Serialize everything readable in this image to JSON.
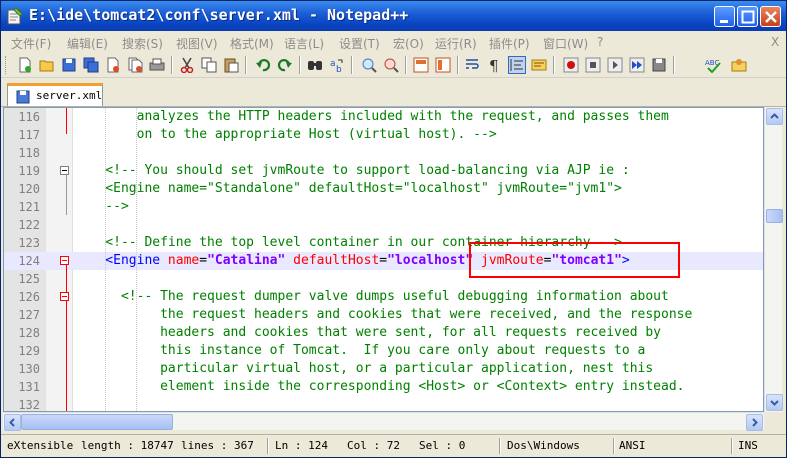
{
  "window": {
    "title": "E:\\ide\\tomcat2\\conf\\server.xml - Notepad++"
  },
  "menu": {
    "items": [
      "文件(F)",
      "编辑(E)",
      "搜索(S)",
      "视图(V)",
      "格式(M)",
      "语言(L)",
      "设置(T)",
      "宏(O)",
      "运行(R)",
      "插件(P)",
      "窗口(W)",
      "?"
    ],
    "close_glyph": "X"
  },
  "toolbar": {
    "icons": [
      "new-file-icon",
      "open-file-icon",
      "save-icon",
      "save-all-icon",
      "close-icon",
      "close-all-icon",
      "print-icon",
      "cut-icon",
      "copy-icon",
      "paste-icon",
      "undo-icon",
      "redo-icon",
      "find-icon",
      "replace-icon",
      "zoom-in-icon",
      "zoom-out-icon",
      "sync-vertical-icon",
      "sync-horizontal-icon",
      "word-wrap-icon",
      "show-all-chars-icon",
      "indent-guide-icon",
      "user-define-icon",
      "record-macro-icon",
      "stop-macro-icon",
      "play-macro-icon",
      "run-macro-multiple-icon",
      "save-macro-icon",
      "spellcheck-icon",
      "plugin-icon"
    ]
  },
  "tabs": [
    {
      "label": "server.xml",
      "active": true
    }
  ],
  "editor": {
    "current_line": 124,
    "lines": [
      {
        "num": "116",
        "parts": [
          {
            "t": "        analyzes the HTTP headers included with the request, and passes them",
            "c": "comment"
          }
        ]
      },
      {
        "num": "117",
        "parts": [
          {
            "t": "        on to the appropriate Host (virtual host). -->",
            "c": "comment"
          }
        ]
      },
      {
        "num": "118",
        "parts": []
      },
      {
        "num": "119",
        "parts": [
          {
            "t": "    <!-- You should set jvmRoute to support load-balancing via AJP ie :",
            "c": "comment"
          }
        ]
      },
      {
        "num": "120",
        "parts": [
          {
            "t": "    <Engine name=\"Standalone\" defaultHost=\"localhost\" jvmRoute=\"jvm1\">",
            "c": "comment"
          }
        ]
      },
      {
        "num": "121",
        "parts": [
          {
            "t": "    -->",
            "c": "comment"
          }
        ]
      },
      {
        "num": "122",
        "parts": []
      },
      {
        "num": "123",
        "parts": [
          {
            "t": "    <!-- Define the top level container in our container hierarchy -->",
            "c": "comment"
          }
        ]
      },
      {
        "num": "124",
        "parts": [
          {
            "t": "    <Engine ",
            "c": "tag"
          },
          {
            "t": "name",
            "c": "attr"
          },
          {
            "t": "=",
            "c": "text"
          },
          {
            "t": "\"Catalina\"",
            "c": "val"
          },
          {
            "t": " ",
            "c": "text"
          },
          {
            "t": "defaultHost",
            "c": "attr"
          },
          {
            "t": "=",
            "c": "text"
          },
          {
            "t": "\"localhost\"",
            "c": "val"
          },
          {
            "t": " ",
            "c": "text"
          },
          {
            "t": "jvmRoute",
            "c": "attr"
          },
          {
            "t": "=",
            "c": "text"
          },
          {
            "t": "\"tomcat1\"",
            "c": "val"
          },
          {
            "t": ">",
            "c": "tag"
          }
        ]
      },
      {
        "num": "125",
        "parts": []
      },
      {
        "num": "126",
        "parts": [
          {
            "t": "      <!-- The request dumper valve dumps useful debugging information about",
            "c": "comment"
          }
        ]
      },
      {
        "num": "127",
        "parts": [
          {
            "t": "           the request headers and cookies that were received, and the response",
            "c": "comment"
          }
        ]
      },
      {
        "num": "128",
        "parts": [
          {
            "t": "           headers and cookies that were sent, for all requests received by",
            "c": "comment"
          }
        ]
      },
      {
        "num": "129",
        "parts": [
          {
            "t": "           this instance of Tomcat.  If you care only about requests to a",
            "c": "comment"
          }
        ]
      },
      {
        "num": "130",
        "parts": [
          {
            "t": "           particular virtual host, or a particular application, nest this",
            "c": "comment"
          }
        ]
      },
      {
        "num": "131",
        "parts": [
          {
            "t": "           element inside the corresponding <Host> or <Context> entry instead.",
            "c": "comment"
          }
        ]
      },
      {
        "num": "132",
        "parts": []
      }
    ]
  },
  "status": {
    "file_type": "eXtensible",
    "length": "length : 18747",
    "lines": "lines : 367",
    "ln": "Ln : 124",
    "col": "Col : 72",
    "sel": "Sel : 0",
    "eol": "Dos\\Windows",
    "encoding": "ANSI",
    "mode": "INS"
  },
  "colors": {
    "comment": "#008000",
    "tag": "#0000ff",
    "attr": "#ff0000",
    "value": "#8000ff",
    "current_line_bg": "#e8e8ff",
    "annotation_box": "#ff0000"
  }
}
